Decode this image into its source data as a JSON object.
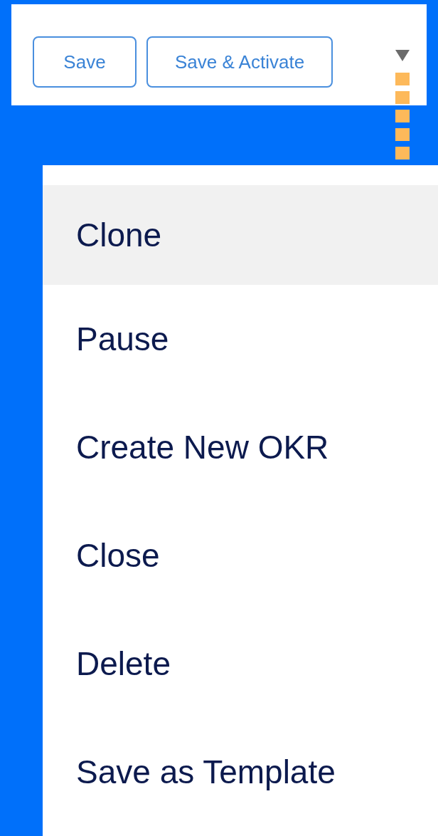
{
  "toolbar": {
    "buttons": [
      "Save",
      "Save & Activate"
    ]
  },
  "menu": {
    "items": [
      {
        "label": "Clone",
        "selected": true
      },
      {
        "label": "Pause",
        "selected": false
      },
      {
        "label": "Create New OKR",
        "selected": false
      },
      {
        "label": "Close",
        "selected": false
      },
      {
        "label": "Delete",
        "selected": false
      },
      {
        "label": "Save as Template",
        "selected": false
      }
    ]
  }
}
